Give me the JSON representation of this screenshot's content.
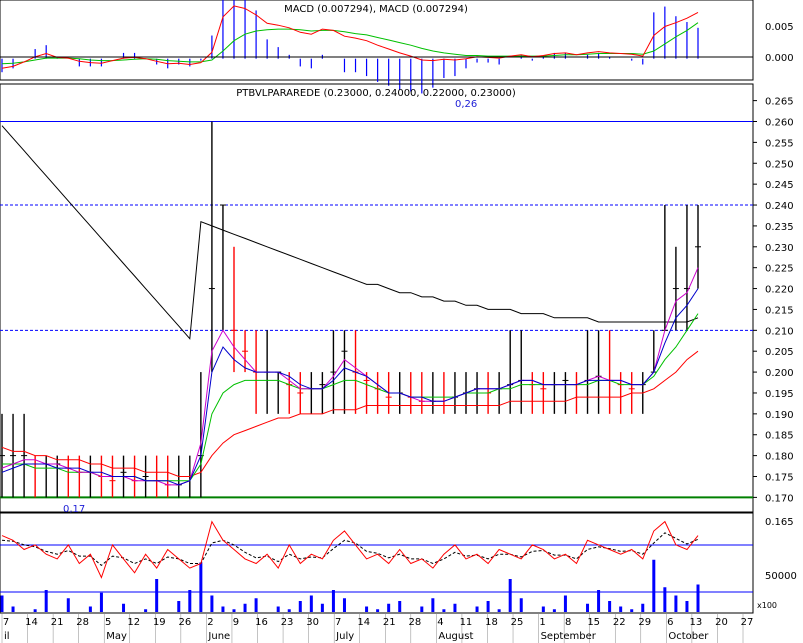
{
  "colors": {
    "up": "#000000",
    "down": "#ff0000",
    "ma_long": "#000000",
    "ma_red": "#ff0000",
    "ma_green": "#00c000",
    "ma_blue": "#0000cc",
    "ma_magenta": "#cc00cc",
    "hist": "#0000ff",
    "ref_line": "#0000ff",
    "support": "#008000",
    "axis": "#000000"
  },
  "chart_data": [
    {
      "panel": "macd",
      "type": "line",
      "title": "MACD (0.007294), MACD (0.007294)",
      "ylim": [
        -0.003,
        0.0085
      ],
      "yticks": [
        "0.005",
        "0.000"
      ],
      "series": [],
      "macd_line": [
        -0.0015,
        -0.0012,
        -0.0005,
        0.0003,
        0.0008,
        0.0002,
        0.0001,
        -0.0004,
        -0.0006,
        -0.0007,
        -0.0003,
        0.0001,
        0.0002,
        0.0,
        -0.0004,
        -0.0008,
        -0.0007,
        -0.0009,
        -0.0006,
        0.001,
        0.0065,
        0.0082,
        0.0078,
        0.0068,
        0.0055,
        0.0052,
        0.0048,
        0.0041,
        0.0038,
        0.0046,
        0.0044,
        0.0035,
        0.0032,
        0.0028,
        0.0021,
        0.0015,
        0.0009,
        0.0004,
        -0.0002,
        -0.0003,
        -0.0001,
        -0.0002,
        0.0,
        0.0003,
        0.0002,
        0.0001,
        0.0004,
        0.0006,
        0.0003,
        0.0005,
        0.0008,
        0.0009,
        0.0006,
        0.0009,
        0.0011,
        0.0009,
        0.0008,
        0.0007,
        0.0004,
        0.0036,
        0.005,
        0.0056,
        0.0063,
        0.0072
      ],
      "signal_line": [
        -0.0008,
        -0.0007,
        -0.0005,
        -0.0002,
        0.0001,
        0.0001,
        0.0001,
        0.0,
        -0.0002,
        -0.0003,
        -0.0003,
        -0.0002,
        -0.0001,
        0.0,
        -0.0001,
        -0.0003,
        -0.0004,
        -0.0005,
        -0.0005,
        -0.0002,
        0.0012,
        0.0028,
        0.0038,
        0.0043,
        0.0045,
        0.0046,
        0.0046,
        0.0045,
        0.0043,
        0.0044,
        0.0044,
        0.0042,
        0.0039,
        0.0037,
        0.0033,
        0.0029,
        0.0025,
        0.0021,
        0.0016,
        0.0012,
        0.0009,
        0.0007,
        0.0005,
        0.0005,
        0.0004,
        0.0004,
        0.0004,
        0.0004,
        0.0004,
        0.0004,
        0.0005,
        0.0006,
        0.0006,
        0.0007,
        0.0008,
        0.0008,
        0.0008,
        0.0008,
        0.0007,
        0.0012,
        0.0023,
        0.0034,
        0.0044,
        0.0056
      ]
    },
    {
      "panel": "price",
      "type": "bar",
      "title": "PTBVLPARAREDE (0.23000, 0.24000, 0.22000, 0.23000)",
      "ylim": [
        0.1665,
        0.2685
      ],
      "yticks": [
        "0.265",
        "0.260",
        "0.255",
        "0.250",
        "0.245",
        "0.240",
        "0.235",
        "0.230",
        "0.225",
        "0.220",
        "0.215",
        "0.210",
        "0.205",
        "0.200",
        "0.195",
        "0.190",
        "0.185",
        "0.180",
        "0.175",
        "0.170"
      ],
      "annotations": [
        {
          "text": "0,26",
          "y": 0.26
        },
        {
          "text": "0,17",
          "y": 0.17
        }
      ],
      "reference_lines": [
        {
          "y": 0.26,
          "style": "solid"
        },
        {
          "y": 0.24,
          "style": "dashed"
        },
        {
          "y": 0.21,
          "style": "dashed"
        },
        {
          "y": 0.17,
          "style": "support"
        }
      ],
      "close": [
        0.18,
        0.18,
        0.18,
        0.178,
        0.178,
        0.178,
        0.177,
        0.176,
        0.176,
        0.175,
        0.174,
        0.176,
        0.174,
        0.175,
        0.174,
        0.173,
        0.173,
        0.175,
        0.18,
        0.22,
        0.24,
        0.21,
        0.205,
        0.2,
        0.2,
        0.2,
        0.197,
        0.195,
        0.196,
        0.197,
        0.2,
        0.205,
        0.2,
        0.198,
        0.196,
        0.194,
        0.195,
        0.194,
        0.193,
        0.193,
        0.192,
        0.194,
        0.195,
        0.196,
        0.195,
        0.196,
        0.197,
        0.198,
        0.197,
        0.196,
        0.197,
        0.198,
        0.197,
        0.198,
        0.199,
        0.198,
        0.197,
        0.196,
        0.197,
        0.2,
        0.21,
        0.22,
        0.22,
        0.23
      ],
      "high": [
        0.19,
        0.19,
        0.19,
        0.18,
        0.18,
        0.18,
        0.18,
        0.18,
        0.18,
        0.18,
        0.18,
        0.18,
        0.18,
        0.18,
        0.18,
        0.18,
        0.18,
        0.18,
        0.2,
        0.26,
        0.24,
        0.23,
        0.21,
        0.21,
        0.21,
        0.2,
        0.2,
        0.2,
        0.2,
        0.2,
        0.21,
        0.21,
        0.21,
        0.2,
        0.2,
        0.2,
        0.2,
        0.2,
        0.2,
        0.2,
        0.2,
        0.2,
        0.2,
        0.2,
        0.2,
        0.2,
        0.21,
        0.21,
        0.2,
        0.2,
        0.2,
        0.2,
        0.2,
        0.21,
        0.21,
        0.21,
        0.2,
        0.2,
        0.2,
        0.21,
        0.24,
        0.23,
        0.24,
        0.24
      ],
      "low": [
        0.17,
        0.17,
        0.17,
        0.17,
        0.17,
        0.17,
        0.17,
        0.17,
        0.17,
        0.17,
        0.17,
        0.17,
        0.17,
        0.17,
        0.17,
        0.17,
        0.17,
        0.17,
        0.17,
        0.2,
        0.21,
        0.2,
        0.2,
        0.19,
        0.19,
        0.19,
        0.19,
        0.19,
        0.19,
        0.19,
        0.19,
        0.19,
        0.19,
        0.19,
        0.19,
        0.19,
        0.19,
        0.19,
        0.19,
        0.19,
        0.19,
        0.19,
        0.19,
        0.19,
        0.19,
        0.19,
        0.19,
        0.19,
        0.19,
        0.19,
        0.19,
        0.19,
        0.19,
        0.19,
        0.19,
        0.19,
        0.19,
        0.19,
        0.19,
        0.2,
        0.21,
        0.21,
        0.21,
        0.22
      ],
      "ma_long": [
        0.259,
        0.256,
        0.253,
        0.25,
        0.247,
        0.244,
        0.241,
        0.238,
        0.235,
        0.232,
        0.229,
        0.226,
        0.223,
        0.22,
        0.217,
        0.214,
        0.211,
        0.208,
        0.236,
        0.235,
        0.234,
        0.233,
        0.232,
        0.231,
        0.23,
        0.229,
        0.228,
        0.227,
        0.226,
        0.225,
        0.224,
        0.223,
        0.222,
        0.221,
        0.221,
        0.22,
        0.219,
        0.219,
        0.218,
        0.218,
        0.217,
        0.217,
        0.216,
        0.216,
        0.215,
        0.215,
        0.215,
        0.214,
        0.214,
        0.214,
        0.213,
        0.213,
        0.213,
        0.213,
        0.212,
        0.212,
        0.212,
        0.212,
        0.212,
        0.212,
        0.212,
        0.212,
        0.212,
        0.213
      ],
      "ma_red": [
        0.182,
        0.181,
        0.181,
        0.18,
        0.18,
        0.179,
        0.179,
        0.179,
        0.178,
        0.178,
        0.177,
        0.177,
        0.177,
        0.176,
        0.176,
        0.176,
        0.175,
        0.175,
        0.176,
        0.18,
        0.183,
        0.185,
        0.186,
        0.187,
        0.188,
        0.189,
        0.189,
        0.19,
        0.19,
        0.19,
        0.191,
        0.191,
        0.191,
        0.192,
        0.192,
        0.192,
        0.192,
        0.192,
        0.192,
        0.192,
        0.192,
        0.192,
        0.192,
        0.192,
        0.192,
        0.192,
        0.193,
        0.193,
        0.193,
        0.193,
        0.193,
        0.193,
        0.194,
        0.194,
        0.194,
        0.194,
        0.194,
        0.195,
        0.195,
        0.196,
        0.198,
        0.2,
        0.203,
        0.205
      ],
      "ma_green": [
        0.178,
        0.178,
        0.178,
        0.177,
        0.177,
        0.177,
        0.176,
        0.176,
        0.176,
        0.175,
        0.175,
        0.175,
        0.175,
        0.174,
        0.174,
        0.174,
        0.174,
        0.174,
        0.178,
        0.19,
        0.195,
        0.197,
        0.198,
        0.198,
        0.198,
        0.198,
        0.197,
        0.196,
        0.196,
        0.196,
        0.197,
        0.198,
        0.198,
        0.197,
        0.196,
        0.195,
        0.195,
        0.194,
        0.194,
        0.194,
        0.194,
        0.194,
        0.195,
        0.195,
        0.195,
        0.196,
        0.196,
        0.197,
        0.197,
        0.197,
        0.197,
        0.197,
        0.197,
        0.197,
        0.198,
        0.198,
        0.197,
        0.197,
        0.197,
        0.199,
        0.203,
        0.206,
        0.21,
        0.214
      ],
      "ma_blue": [
        0.176,
        0.177,
        0.178,
        0.178,
        0.178,
        0.177,
        0.177,
        0.177,
        0.176,
        0.176,
        0.175,
        0.175,
        0.175,
        0.174,
        0.174,
        0.174,
        0.173,
        0.174,
        0.18,
        0.2,
        0.206,
        0.203,
        0.201,
        0.2,
        0.2,
        0.2,
        0.199,
        0.197,
        0.196,
        0.196,
        0.198,
        0.201,
        0.2,
        0.199,
        0.197,
        0.195,
        0.195,
        0.194,
        0.194,
        0.193,
        0.193,
        0.194,
        0.195,
        0.196,
        0.196,
        0.196,
        0.197,
        0.198,
        0.198,
        0.197,
        0.197,
        0.197,
        0.197,
        0.198,
        0.198,
        0.198,
        0.198,
        0.197,
        0.197,
        0.2,
        0.207,
        0.213,
        0.216,
        0.22
      ],
      "ma_magenta": [
        0.177,
        0.178,
        0.179,
        0.179,
        0.178,
        0.178,
        0.177,
        0.176,
        0.176,
        0.175,
        0.175,
        0.175,
        0.174,
        0.174,
        0.174,
        0.173,
        0.173,
        0.174,
        0.183,
        0.205,
        0.21,
        0.206,
        0.203,
        0.2,
        0.2,
        0.2,
        0.198,
        0.196,
        0.196,
        0.196,
        0.199,
        0.203,
        0.201,
        0.199,
        0.197,
        0.195,
        0.195,
        0.194,
        0.193,
        0.193,
        0.193,
        0.194,
        0.195,
        0.196,
        0.196,
        0.196,
        0.197,
        0.198,
        0.198,
        0.197,
        0.197,
        0.197,
        0.197,
        0.198,
        0.199,
        0.198,
        0.198,
        0.197,
        0.197,
        0.2,
        0.21,
        0.217,
        0.219,
        0.225
      ]
    },
    {
      "panel": "oscillator_volume",
      "type": "line",
      "title": "",
      "yticks": [
        "0.165",
        "50000"
      ],
      "unit_label": "x100",
      "ylim": [
        0,
        100
      ],
      "osc_line": [
        80,
        75,
        65,
        70,
        60,
        55,
        70,
        50,
        60,
        35,
        70,
        55,
        40,
        60,
        45,
        65,
        55,
        45,
        50,
        95,
        75,
        65,
        55,
        50,
        60,
        45,
        70,
        50,
        60,
        55,
        75,
        85,
        70,
        55,
        60,
        50,
        65,
        50,
        55,
        45,
        60,
        70,
        55,
        60,
        50,
        65,
        60,
        55,
        70,
        65,
        55,
        60,
        50,
        75,
        70,
        65,
        60,
        65,
        55,
        85,
        95,
        70,
        65,
        80
      ],
      "osc_signal": [
        75,
        74,
        70,
        68,
        63,
        60,
        64,
        58,
        58,
        48,
        58,
        56,
        50,
        55,
        50,
        57,
        55,
        50,
        50,
        72,
        75,
        70,
        62,
        56,
        58,
        52,
        60,
        55,
        57,
        56,
        66,
        75,
        72,
        63,
        61,
        56,
        60,
        55,
        55,
        50,
        55,
        62,
        58,
        59,
        55,
        60,
        60,
        57,
        63,
        64,
        59,
        59,
        55,
        65,
        68,
        66,
        63,
        64,
        60,
        72,
        83,
        77,
        71,
        76
      ],
      "volume": [
        30,
        10,
        0,
        5,
        40,
        0,
        25,
        0,
        10,
        35,
        0,
        15,
        0,
        5,
        60,
        0,
        20,
        40,
        90,
        30,
        10,
        5,
        15,
        25,
        0,
        10,
        5,
        20,
        30,
        15,
        40,
        25,
        0,
        10,
        5,
        15,
        20,
        0,
        10,
        25,
        5,
        15,
        0,
        10,
        20,
        5,
        60,
        25,
        0,
        10,
        5,
        30,
        0,
        15,
        40,
        20,
        10,
        5,
        15,
        95,
        45,
        30,
        20,
        50
      ]
    }
  ],
  "xaxis": {
    "ticks": [
      "7",
      "14",
      "21",
      "28",
      "5",
      "12",
      "19",
      "26",
      "2",
      "9",
      "16",
      "23",
      "30",
      "7",
      "14",
      "21",
      "28",
      "4",
      "11",
      "18",
      "25",
      "1",
      "8",
      "15",
      "22",
      "29",
      "6",
      "13",
      "20",
      "27"
    ],
    "months": [
      "il",
      "May",
      "June",
      "July",
      "August",
      "September",
      "October"
    ]
  }
}
